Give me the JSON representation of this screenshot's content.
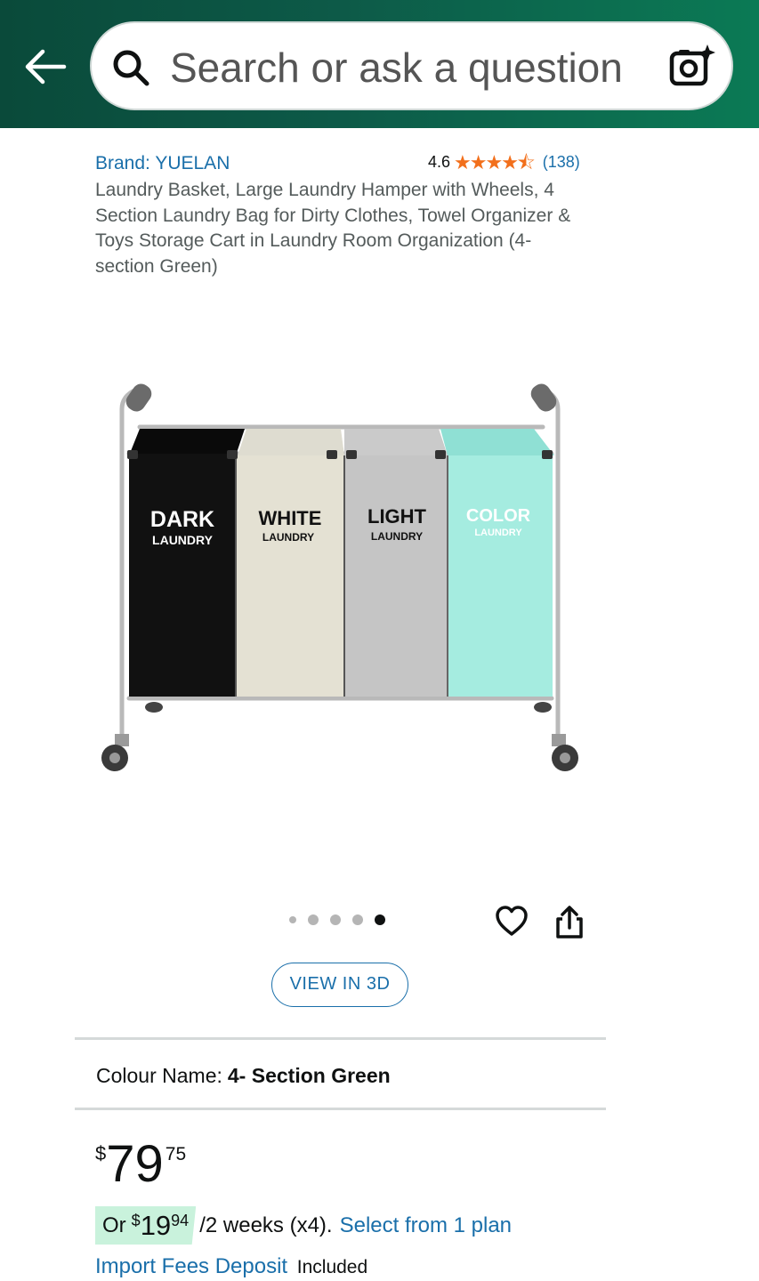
{
  "header": {
    "search_placeholder": "Search or ask a question",
    "back_icon": "arrow-left-icon",
    "search_icon": "magnifier-icon",
    "camera_icon": "camera-sparkle-icon",
    "gradient_colors": [
      "#0a4a3a",
      "#0b7a55"
    ]
  },
  "product": {
    "brand": "Brand: YUELAN",
    "rating": "4.6",
    "stars": "★★★★⯪",
    "rating_value": 4.6,
    "review_count": "(138)",
    "title": "Laundry Basket, Large Laundry Hamper with Wheels, 4 Section Laundry Bag for Dirty Clothes, Towel Organizer & Toys Storage Cart in Laundry Room Organization (4- section Green)",
    "image": {
      "bags": [
        {
          "big": "DARK",
          "small": "LAUNDRY",
          "color": "#111111"
        },
        {
          "big": "WHITE",
          "small": "LAUNDRY",
          "color": "#e4e1d3"
        },
        {
          "big": "LIGHT",
          "small": "LAUNDRY",
          "color": "#c5c5c5"
        },
        {
          "big": "COLOR",
          "small": "LAUNDRY",
          "color": "#a5ece0"
        }
      ]
    }
  },
  "gallery": {
    "image_count": 5,
    "active_index": 4,
    "heart_icon": "heart-icon",
    "share_icon": "share-icon"
  },
  "view3d_label": "VIEW IN 3D",
  "colour": {
    "label": "Colour Name:",
    "value": "4- Section Green"
  },
  "price": {
    "symbol": "$",
    "whole": "79",
    "fraction": "75"
  },
  "plan": {
    "prefix": "Or",
    "symbol": "$",
    "whole": "19",
    "fraction": "94",
    "suffix": "/2 weeks (x4).",
    "link": "Select from 1 plan",
    "highlight_color": "#c9f2dc"
  },
  "fees": {
    "link": "Import Fees Deposit",
    "status": "Included"
  },
  "colors": {
    "link": "#1a6faa",
    "star": "#f26f1b"
  }
}
